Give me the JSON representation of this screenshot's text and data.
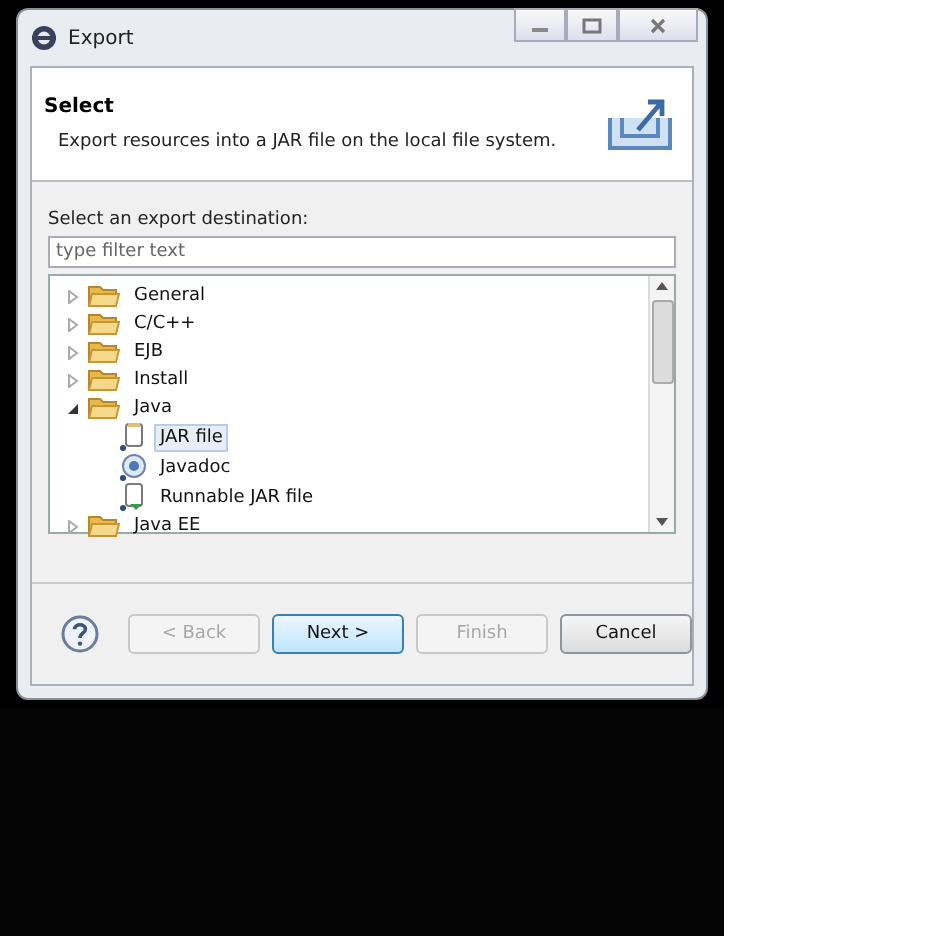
{
  "window": {
    "title": "Export"
  },
  "header": {
    "title": "Select",
    "description": "Export resources into a JAR file on the local file system."
  },
  "destination": {
    "label": "Select an export destination:",
    "filter": {
      "placeholder": "type filter text"
    }
  },
  "tree": [
    {
      "label": "General",
      "kind": "folder",
      "expanded": false,
      "selected": false
    },
    {
      "label": "C/C++",
      "kind": "folder",
      "expanded": false,
      "selected": false
    },
    {
      "label": "EJB",
      "kind": "folder",
      "expanded": false,
      "selected": false
    },
    {
      "label": "Install",
      "kind": "folder",
      "expanded": false,
      "selected": false
    },
    {
      "label": "Java",
      "kind": "folder",
      "expanded": true,
      "selected": false,
      "children": [
        {
          "label": "JAR file",
          "kind": "jar",
          "selected": true
        },
        {
          "label": "Javadoc",
          "kind": "javadoc",
          "selected": false
        },
        {
          "label": "Runnable JAR file",
          "kind": "runnable",
          "selected": false
        }
      ]
    },
    {
      "label": "Java EE",
      "kind": "folder",
      "expanded": false,
      "selected": false
    }
  ],
  "buttons": [
    {
      "label": "< Back",
      "disabled": true,
      "default": false
    },
    {
      "label": "Next >",
      "disabled": false,
      "default": true
    },
    {
      "label": "Finish",
      "disabled": true,
      "default": false
    },
    {
      "label": "Cancel",
      "disabled": false,
      "default": false
    }
  ]
}
